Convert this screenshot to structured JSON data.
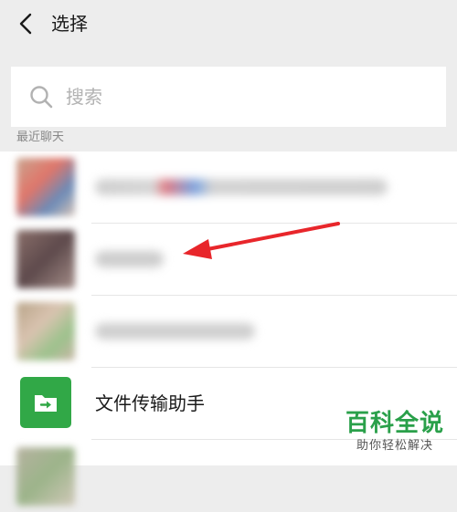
{
  "header": {
    "title": "选择",
    "back_icon": "chevron-left-icon"
  },
  "search": {
    "placeholder": "搜索",
    "icon": "search-icon"
  },
  "section": {
    "recent_label": "最近聊天"
  },
  "chats": [
    {
      "name": "",
      "blurred": true
    },
    {
      "name": "",
      "blurred": true,
      "highlighted_by_arrow": true
    },
    {
      "name": "",
      "blurred": true
    },
    {
      "name": "文件传输助手",
      "blurred": false,
      "icon": "folder-arrow-icon",
      "icon_color": "#31a847"
    },
    {
      "name": "",
      "blurred": true
    }
  ],
  "annotation": {
    "type": "arrow",
    "color": "#e8262b"
  },
  "watermark": {
    "title": "百科全说",
    "subtitle": "助你轻松解决"
  },
  "colors": {
    "background": "#ededed",
    "list_bg": "#ffffff",
    "accent_green": "#31a847"
  }
}
